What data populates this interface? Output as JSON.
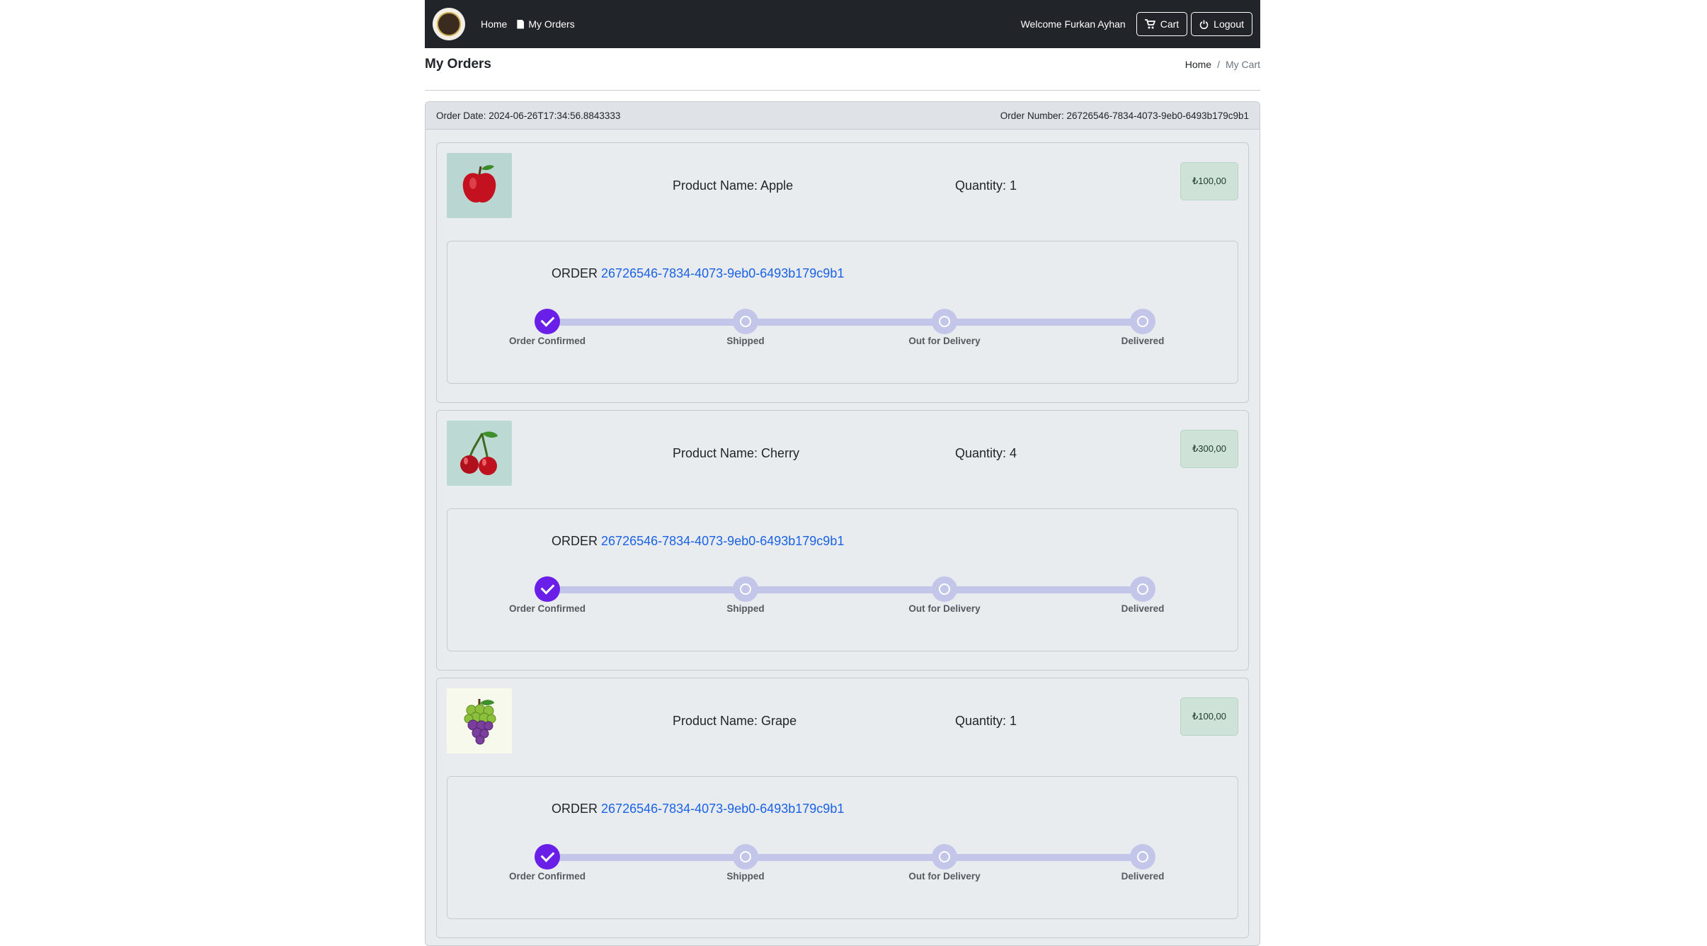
{
  "nav": {
    "home_label": "Home",
    "orders_label": "My Orders",
    "welcome": "Welcome Furkan Ayhan",
    "cart_label": "Cart",
    "logout_label": "Logout"
  },
  "page": {
    "title": "My Orders",
    "breadcrumb": {
      "home": "Home",
      "sep": "/",
      "current": "My Cart"
    }
  },
  "order": {
    "date_text": "Order Date: 2024-06-26T17:34:56.8843333",
    "number_text": "Order Number: 26726546-7834-4073-9eb0-6493b179c9b1"
  },
  "tracking_prefix": "ORDER",
  "steps": [
    "Order Confirmed",
    "Shipped",
    "Out for Delivery",
    "Delivered"
  ],
  "items": [
    {
      "name": "Product Name: Apple",
      "quantity": "Quantity: 1",
      "price": "₺100,00",
      "order_id": "26726546-7834-4073-9eb0-6493b179c9b1",
      "image_icon": "apple-image"
    },
    {
      "name": "Product Name: Cherry",
      "quantity": "Quantity: 4",
      "price": "₺300,00",
      "order_id": "26726546-7834-4073-9eb0-6493b179c9b1",
      "image_icon": "cherry-image"
    },
    {
      "name": "Product Name: Grape",
      "quantity": "Quantity: 1",
      "price": "₺100,00",
      "order_id": "26726546-7834-4073-9eb0-6493b179c9b1",
      "image_icon": "grape-image"
    }
  ],
  "colors": {
    "navbar": "#212529",
    "accent": "#6a1fe8",
    "link": "#1a62e5",
    "price_bg": "#cfe2d8"
  }
}
